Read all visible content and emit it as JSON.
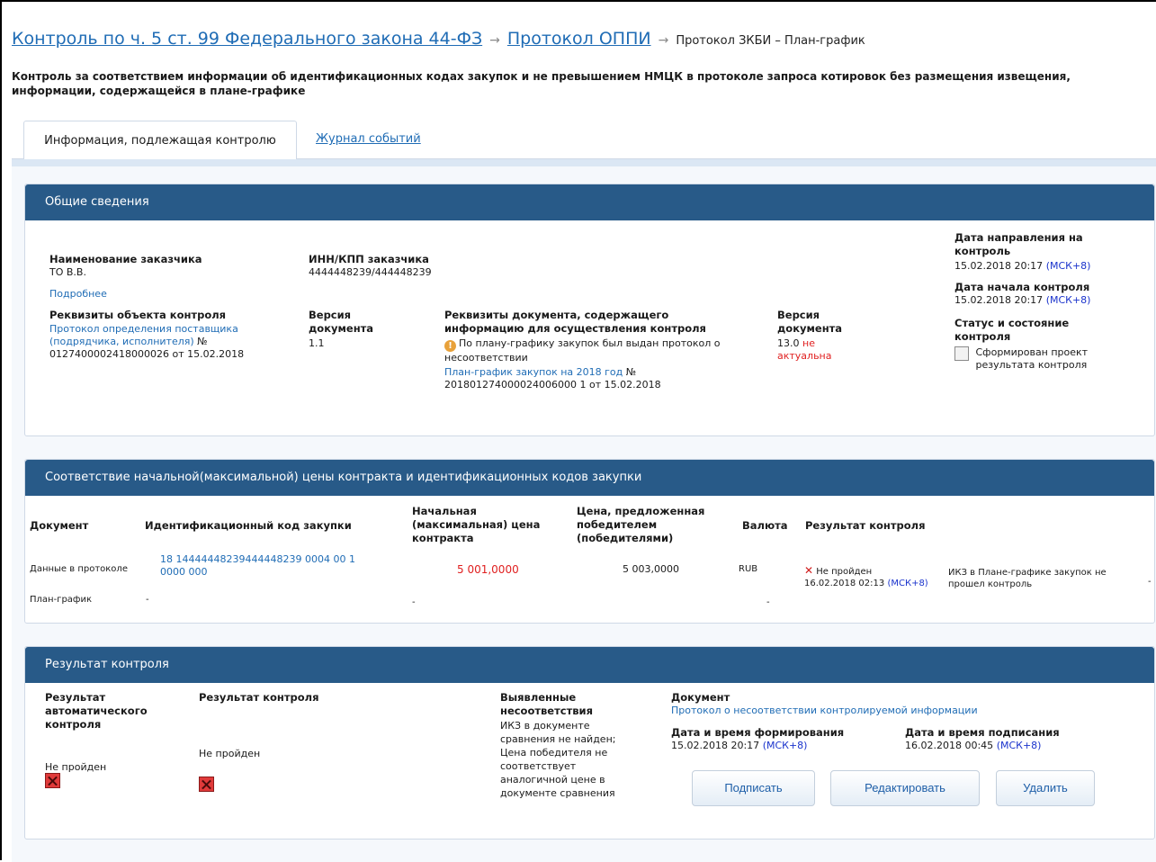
{
  "breadcrumb": {
    "item1": "Контроль по ч. 5 ст. 99 Федерального закона 44-ФЗ",
    "item2": "Протокол ОППИ",
    "current": "Протокол ЗКБИ – План-график",
    "separator": "→"
  },
  "subtitle": "Контроль за соответствием информации об идентификационных кодах закупок и не превышением НМЦК в протоколе запроса котировок без размещения извещения, информации, содержащейся в плане-графике",
  "tabs": [
    {
      "label": "Информация, подлежащая контролю",
      "active": true
    },
    {
      "label": "Журнал событий",
      "active": false
    }
  ],
  "general": {
    "title": "Общие сведения",
    "customer_name_label": "Наименование заказчика",
    "customer_name": "ТО В.В.",
    "more_link": "Подробнее",
    "inn_label": "ИНН/КПП заказчика",
    "inn": "4444448239/444448239",
    "object_label": "Реквизиты объекта контроля",
    "object_link": "Протокол определения поставщика (подрядчика, исполнителя)",
    "object_number": " № 0127400002418000026 от 15.02.2018",
    "version_label_1": "Версия документа",
    "version_1": "1.1",
    "doc_label": "Реквизиты документа, содержащего информацию для осуществления контроля",
    "doc_warning": "По плану-графику закупок был выдан протокол о несоответствии",
    "doc_link": "План-график закупок на 2018 год",
    "doc_number": " № 201801274000024006000 1 от 15.02.2018",
    "version_label_2": "Версия документа",
    "version_2": "13.0",
    "version_2_status": "не актуальна",
    "sent_label": "Дата направления на контроль",
    "sent_date": "15.02.2018 20:17",
    "tz": "(МСК+8)",
    "start_label": "Дата начала контроля",
    "start_date": "15.02.2018 20:17",
    "status_label": "Статус и состояние контроля",
    "status_value": "Сформирован проект результата контроля"
  },
  "compliance": {
    "title": "Соответствие начальной(максимальной) цены контракта и идентификационных кодов закупки",
    "headers": {
      "document": "Документ",
      "code": "Идентификационный код закупки",
      "price": "Начальная (максимальная) цена контракта",
      "winner_price": "Цена, предложенная победителем (победителями)",
      "currency": "Валюта",
      "result": "Результат контроля"
    },
    "rows": [
      {
        "document": "Данные в протоколе",
        "code": "18 14444448239444448239 0004 00 1 0000 000",
        "price": "5 001,0000",
        "winner_price": "5 003,0000",
        "currency": "RUB",
        "result_status": "Не пройден",
        "result_date": "16.02.2018 02:13",
        "result_tz": "(МСК+8)",
        "note": "ИКЗ в Плане-графике закупок не прошел контроль",
        "tail": "-"
      },
      {
        "document": "План-график",
        "code": "-",
        "price": "-",
        "currency": "-"
      }
    ]
  },
  "result": {
    "title": "Результат контроля",
    "auto_label": "Результат автоматического контроля",
    "auto_value": "Не пройден",
    "control_label": "Результат контроля",
    "control_value": "Не пройден",
    "found_label": "Выявленные несоответствия",
    "found_value": "ИКЗ в документе сравнения не найден; Цена победителя не соответствует аналогичной цене в документе сравнения",
    "document_label": "Документ",
    "document_link": "Протокол о несоответствии контролируемой информации",
    "formed_label": "Дата и время формирования",
    "formed_date": "15.02.2018 20:17",
    "signed_label": "Дата и время подписания",
    "signed_date": "16.02.2018 00:45",
    "tz": "(МСК+8)",
    "buttons": {
      "sign": "Подписать",
      "edit": "Редактировать",
      "delete": "Удалить"
    }
  }
}
